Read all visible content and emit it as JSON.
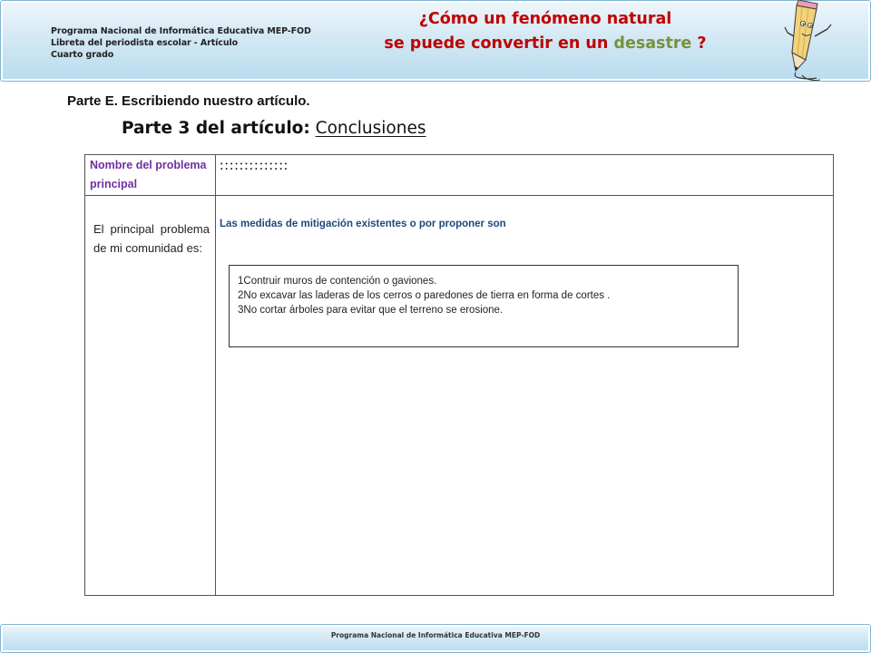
{
  "header": {
    "info_lines": [
      "Programa Nacional de Informática Educativa MEP-FOD",
      "Libreta del periodista escolar -  Artículo",
      "Cuarto grado"
    ],
    "title_line1": "¿Cómo un fenómeno natural",
    "title_line2_start": "se puede convertir en un ",
    "title_line2_accent": "desastre",
    "title_line2_end": " ?",
    "title_color": "#c00000",
    "accent_color": "#76923c"
  },
  "part_heading": "Parte E. Escribiendo nuestro artículo.",
  "subtitle": {
    "lead": "Parte 3 del artículo:",
    "topic": "Conclusiones"
  },
  "table": {
    "name_label": "Nombre del problema principal",
    "name_value": "::::::::::::::",
    "problem_label": "El principal problema de mi comunidad es:",
    "measures_label": "Las medidas de mitigación  existentes o por proponer son",
    "measures": [
      "1Contruir muros de contención o gaviones.",
      "2No excavar las laderas de los cerros o paredones de tierra en forma de cortes .",
      "3No cortar árboles para evitar que el terreno se erosione."
    ],
    "label_color": "#7030a0",
    "measures_label_color": "#1f497d"
  },
  "footer": {
    "text": "Programa  Nacional de Informática  Educativa MEP-FOD"
  },
  "icons": {
    "mascot": "pencil-character-icon"
  }
}
